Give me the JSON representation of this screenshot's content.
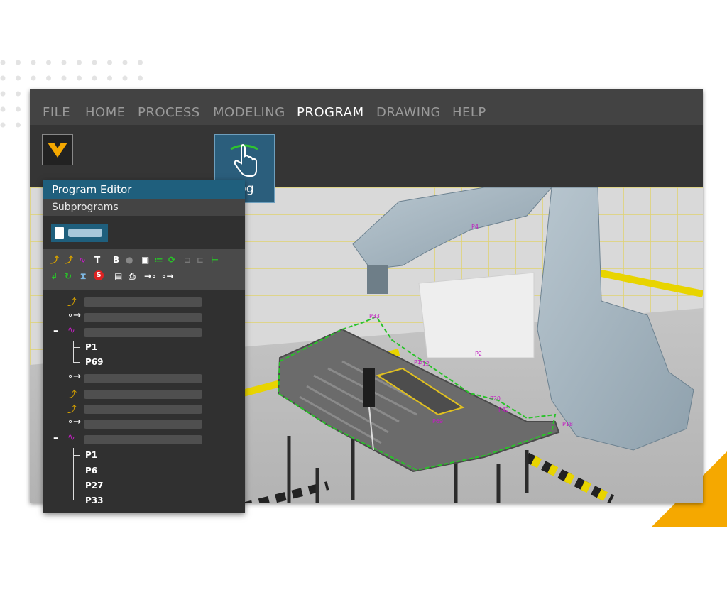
{
  "menu": {
    "items": [
      "FILE",
      "HOME",
      "PROCESS",
      "MODELING",
      "PROGRAM",
      "DRAWING",
      "HELP"
    ],
    "active": "PROGRAM"
  },
  "jog": {
    "label": "Jog"
  },
  "panel": {
    "title": "Program Editor",
    "subtab": "Subprograms",
    "tree": {
      "group1_points": [
        "P1",
        "P69"
      ],
      "group2_points": [
        "P1",
        "P6",
        "P27",
        "P33"
      ]
    }
  },
  "toolbar": {
    "t_label": "T",
    "b_label": "B",
    "s_label": "S"
  },
  "viewport": {
    "point_labels": [
      "P4",
      "P2",
      "P1",
      "P69",
      "P12",
      "P20",
      "P42",
      "P33",
      "P18"
    ]
  },
  "colors": {
    "accent_blue": "#1f5f7d",
    "brand_yellow": "#f5a800",
    "path_green": "#29c229",
    "point_magenta": "#c21ec2"
  }
}
